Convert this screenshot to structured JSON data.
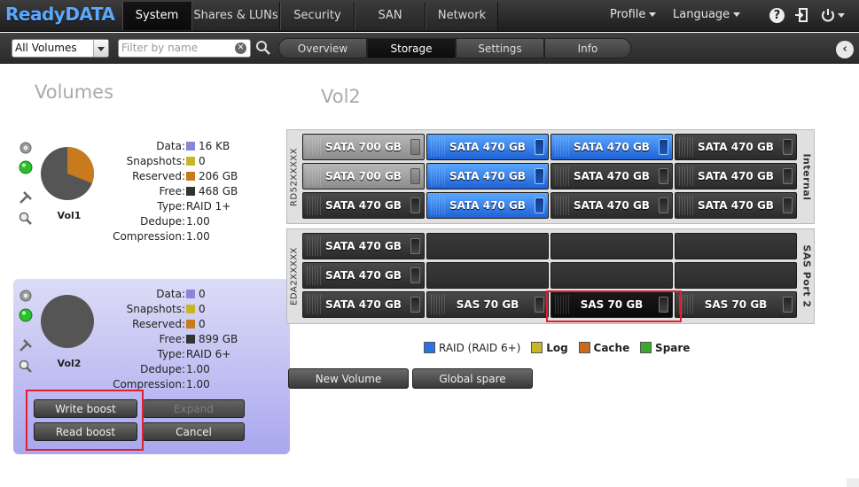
{
  "app": {
    "logo": "ReadyDATA"
  },
  "nav": {
    "tabs": [
      "System",
      "Shares & LUNs",
      "Security",
      "SAN",
      "Network"
    ],
    "active": "System",
    "profile_label": "Profile",
    "language_label": "Language"
  },
  "toolbar": {
    "volume_select_value": "All Volumes",
    "filter_placeholder": "Filter by name",
    "tabs": [
      "Overview",
      "Storage",
      "Settings",
      "Info"
    ],
    "active_tab": "Storage"
  },
  "volumes_panel": {
    "title": "Volumes",
    "volumes": [
      {
        "name": "Vol1",
        "used_fraction": 0.31,
        "stats": [
          {
            "label": "Data:",
            "value": "16 KB",
            "swatch": "#8b85d6"
          },
          {
            "label": "Snapshots:",
            "value": "0",
            "swatch": "#c8b52a"
          },
          {
            "label": "Reserved:",
            "value": "206 GB",
            "swatch": "#c87a1e"
          },
          {
            "label": "Free:",
            "value": "468 GB",
            "swatch": "#333333"
          },
          {
            "label": "Type:",
            "value": "RAID 1+"
          },
          {
            "label": "Dedupe:",
            "value": "1.00"
          },
          {
            "label": "Compression:",
            "value": "1.00"
          }
        ]
      },
      {
        "name": "Vol2",
        "used_fraction": 0,
        "stats": [
          {
            "label": "Data:",
            "value": "0",
            "swatch": "#8b85d6"
          },
          {
            "label": "Snapshots:",
            "value": "0",
            "swatch": "#c8b52a"
          },
          {
            "label": "Reserved:",
            "value": "0",
            "swatch": "#c87a1e"
          },
          {
            "label": "Free:",
            "value": "899 GB",
            "swatch": "#333333"
          },
          {
            "label": "Type:",
            "value": "RAID 6+"
          },
          {
            "label": "Dedupe:",
            "value": "1.00"
          },
          {
            "label": "Compression:",
            "value": "1.00"
          }
        ],
        "buttons": {
          "write_boost": "Write boost",
          "expand": "Expand",
          "read_boost": "Read boost",
          "cancel": "Cancel"
        }
      }
    ]
  },
  "storage_panel": {
    "title": "Vol2",
    "enclosures": [
      {
        "left_label": "RD52XXXXX",
        "right_label": "Internal",
        "rows": [
          [
            {
              "label": "SATA 700 GB",
              "state": "gray"
            },
            {
              "label": "SATA 470 GB",
              "state": "raid"
            },
            {
              "label": "SATA 470 GB",
              "state": "raid"
            },
            {
              "label": "SATA 470 GB",
              "state": "normal"
            }
          ],
          [
            {
              "label": "SATA 700 GB",
              "state": "gray"
            },
            {
              "label": "SATA 470 GB",
              "state": "raid"
            },
            {
              "label": "SATA 470 GB",
              "state": "normal"
            },
            {
              "label": "SATA 470 GB",
              "state": "normal"
            }
          ],
          [
            {
              "label": "SATA 470 GB",
              "state": "normal"
            },
            {
              "label": "SATA 470 GB",
              "state": "raid"
            },
            {
              "label": "SATA 470 GB",
              "state": "normal"
            },
            {
              "label": "SATA 470 GB",
              "state": "normal"
            }
          ]
        ]
      },
      {
        "left_label": "EDA2XXXXX",
        "right_label": "SAS Port 2",
        "rows": [
          [
            {
              "label": "SATA 470 GB",
              "state": "normal"
            },
            {
              "label": "",
              "state": "empty"
            },
            {
              "label": "",
              "state": "empty"
            },
            {
              "label": "",
              "state": "empty"
            }
          ],
          [
            {
              "label": "SATA 470 GB",
              "state": "normal"
            },
            {
              "label": "",
              "state": "empty"
            },
            {
              "label": "",
              "state": "empty"
            },
            {
              "label": "",
              "state": "empty"
            }
          ],
          [
            {
              "label": "SATA 470 GB",
              "state": "normal"
            },
            {
              "label": "SAS 70 GB",
              "state": "normal"
            },
            {
              "label": "SAS 70 GB",
              "state": "selected"
            },
            {
              "label": "SAS 70 GB",
              "state": "normal"
            }
          ]
        ]
      }
    ],
    "legend": [
      {
        "label": "RAID (RAID 6+)",
        "color": "#2d72e0",
        "bold": false
      },
      {
        "label": "Log",
        "color": "#c8b52a",
        "bold": true
      },
      {
        "label": "Cache",
        "color": "#c8691e",
        "bold": true
      },
      {
        "label": "Spare",
        "color": "#3aa82e",
        "bold": true
      }
    ],
    "buttons": {
      "new_volume": "New Volume",
      "global_spare": "Global spare"
    }
  },
  "colors": {
    "accent": "#5aa9ff",
    "highlight": "#e02030",
    "vol2_panel": "#b9b7f1"
  }
}
